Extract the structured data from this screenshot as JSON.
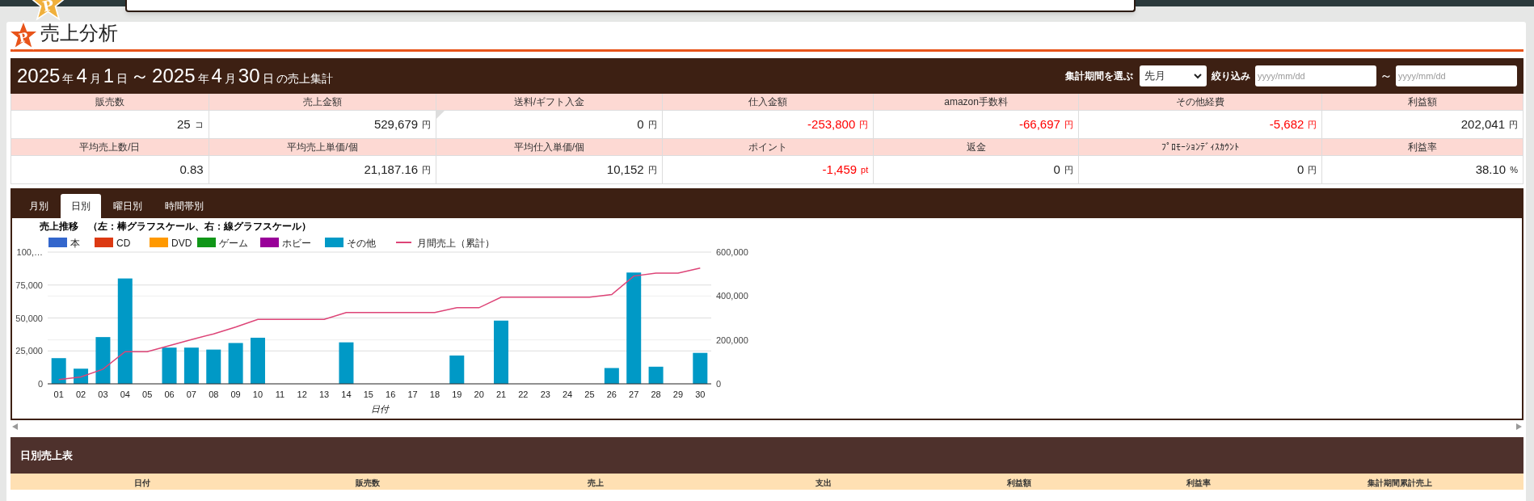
{
  "top_logo": {
    "letter": "P"
  },
  "page_title": {
    "icon_letter": "P",
    "text": "売上分析"
  },
  "period_header": {
    "parts": [
      {
        "text": "2025",
        "kind": "big"
      },
      {
        "text": "年",
        "kind": "small"
      },
      {
        "text": "4",
        "kind": "big"
      },
      {
        "text": "月",
        "kind": "small"
      },
      {
        "text": "1",
        "kind": "big"
      },
      {
        "text": "日",
        "kind": "small"
      },
      {
        "text": "～",
        "kind": "big"
      },
      {
        "text": "2025",
        "kind": "big"
      },
      {
        "text": "年",
        "kind": "small"
      },
      {
        "text": "4",
        "kind": "big"
      },
      {
        "text": "月",
        "kind": "small"
      },
      {
        "text": "30",
        "kind": "big"
      },
      {
        "text": "日",
        "kind": "small"
      },
      {
        "text": "の売上集計",
        "kind": "small"
      }
    ],
    "period_label": "集計期間を選ぶ",
    "period_select": "先月",
    "filter_label": "絞り込み",
    "from_placeholder": "yyyy/mm/dd",
    "range_sep": "～",
    "to_placeholder": "yyyy/mm/dd"
  },
  "summary": [
    [
      {
        "label": "販売数",
        "value": "25",
        "unit": "コ",
        "negative": false
      },
      {
        "label": "売上金額",
        "value": "529,679",
        "unit": "円",
        "negative": false
      },
      {
        "label": "送料/ギフト入金",
        "value": "0",
        "unit": "円",
        "negative": false
      },
      {
        "label": "仕入金額",
        "value": "-253,800",
        "unit": "円",
        "negative": true
      },
      {
        "label": "amazon手数料",
        "value": "-66,697",
        "unit": "円",
        "negative": true
      },
      {
        "label": "その他経費",
        "value": "-5,682",
        "unit": "円",
        "negative": true
      },
      {
        "label": "利益額",
        "value": "202,041",
        "unit": "円",
        "negative": false
      }
    ],
    [
      {
        "label": "平均売上数/日",
        "value": "0.83",
        "negative": false
      },
      {
        "label": "平均売上単価/個",
        "value": "21,187.16",
        "unit": "円",
        "negative": false
      },
      {
        "label": "平均仕入単価/個",
        "value": "10,152",
        "unit": "円",
        "negative": false
      },
      {
        "label": "ポイント",
        "value": "-1,459",
        "unit": "pt",
        "negative": true
      },
      {
        "label": "返金",
        "value": "0",
        "unit": "円",
        "negative": false
      },
      {
        "label": "ﾌﾟﾛﾓｰｼｮﾝﾃﾞｨｽｶｳﾝﾄ",
        "value": "0",
        "unit": "円",
        "negative": false
      },
      {
        "label": "利益率",
        "value": "38.10",
        "unit": "%",
        "negative": false
      }
    ]
  ],
  "tabs": [
    {
      "label": "月別",
      "selected": false
    },
    {
      "label": "日別",
      "selected": true
    },
    {
      "label": "曜日別",
      "selected": false
    },
    {
      "label": "時間帯別",
      "selected": false
    }
  ],
  "chart_data": {
    "type": "bar",
    "title": "売上推移　（左：棒グラフスケール、右：線グラフスケール）",
    "xlabel": "日付",
    "grid": true,
    "legend": "top",
    "categories": [
      "01",
      "02",
      "03",
      "04",
      "05",
      "06",
      "07",
      "08",
      "09",
      "10",
      "11",
      "12",
      "13",
      "14",
      "15",
      "16",
      "17",
      "18",
      "19",
      "20",
      "21",
      "22",
      "23",
      "24",
      "25",
      "26",
      "27",
      "28",
      "29",
      "30"
    ],
    "ylim": [
      0,
      100000
    ],
    "yticks": [
      0,
      {
        "value": 25000,
        "label": "25,000"
      },
      {
        "value": 50000,
        "label": "50,000"
      },
      {
        "value": 75000,
        "label": "75,000"
      },
      {
        "value": 100000,
        "label": "100,…"
      }
    ],
    "y2lim": [
      0,
      600000
    ],
    "y2ticks": [
      0,
      {
        "value": 200000,
        "label": "200,000"
      },
      {
        "value": 400000,
        "label": "400,000"
      },
      {
        "value": 600000,
        "label": "600,000"
      }
    ],
    "series": [
      {
        "name": "本",
        "color": "#3366cc",
        "values": [
          0,
          0,
          0,
          0,
          0,
          0,
          0,
          0,
          0,
          0,
          0,
          0,
          0,
          0,
          0,
          0,
          0,
          0,
          0,
          0,
          0,
          0,
          0,
          0,
          0,
          0,
          0,
          0,
          0,
          0
        ]
      },
      {
        "name": "CD",
        "color": "#dc3912",
        "values": [
          0,
          0,
          0,
          0,
          0,
          0,
          0,
          0,
          0,
          0,
          0,
          0,
          0,
          0,
          0,
          0,
          0,
          0,
          0,
          0,
          0,
          0,
          0,
          0,
          0,
          0,
          0,
          0,
          0,
          0
        ]
      },
      {
        "name": "DVD",
        "color": "#ff9900",
        "values": [
          0,
          0,
          0,
          0,
          0,
          0,
          0,
          0,
          0,
          0,
          0,
          0,
          0,
          0,
          0,
          0,
          0,
          0,
          0,
          0,
          0,
          0,
          0,
          0,
          0,
          0,
          0,
          0,
          0,
          0
        ]
      },
      {
        "name": "ゲーム",
        "color": "#109618",
        "values": [
          0,
          0,
          0,
          0,
          0,
          0,
          0,
          0,
          0,
          0,
          0,
          0,
          0,
          0,
          0,
          0,
          0,
          0,
          0,
          0,
          0,
          0,
          0,
          0,
          0,
          0,
          0,
          0,
          0,
          0
        ]
      },
      {
        "name": "ホビー",
        "color": "#990099",
        "values": [
          0,
          0,
          0,
          0,
          0,
          0,
          0,
          0,
          0,
          0,
          0,
          0,
          0,
          0,
          0,
          0,
          0,
          0,
          0,
          0,
          0,
          0,
          0,
          0,
          0,
          0,
          0,
          0,
          0,
          0
        ]
      },
      {
        "name": "その他",
        "color": "#0099c6",
        "values": [
          19500,
          11500,
          35500,
          80000,
          0,
          27500,
          27500,
          26000,
          31000,
          35000,
          0,
          0,
          0,
          31500,
          0,
          0,
          0,
          0,
          21500,
          0,
          48000,
          0,
          0,
          0,
          0,
          12000,
          84500,
          13000,
          0,
          23500
        ]
      },
      {
        "name": "月間売上（累計）",
        "color": "#dd4477",
        "type": "line",
        "axis": "y2",
        "values": [
          19500,
          31000,
          66500,
          146500,
          146500,
          174000,
          201500,
          227500,
          258500,
          293500,
          293500,
          293500,
          293500,
          325000,
          325000,
          325000,
          325000,
          325000,
          346500,
          346500,
          394500,
          394500,
          394500,
          394500,
          394500,
          406500,
          491000,
          504000,
          504000,
          527500
        ]
      }
    ]
  },
  "daily_table": {
    "title": "日別売上表",
    "columns": [
      "日付",
      "販売数",
      "売上",
      "支出",
      "利益額",
      "利益率",
      "集計期間累計売上"
    ]
  }
}
